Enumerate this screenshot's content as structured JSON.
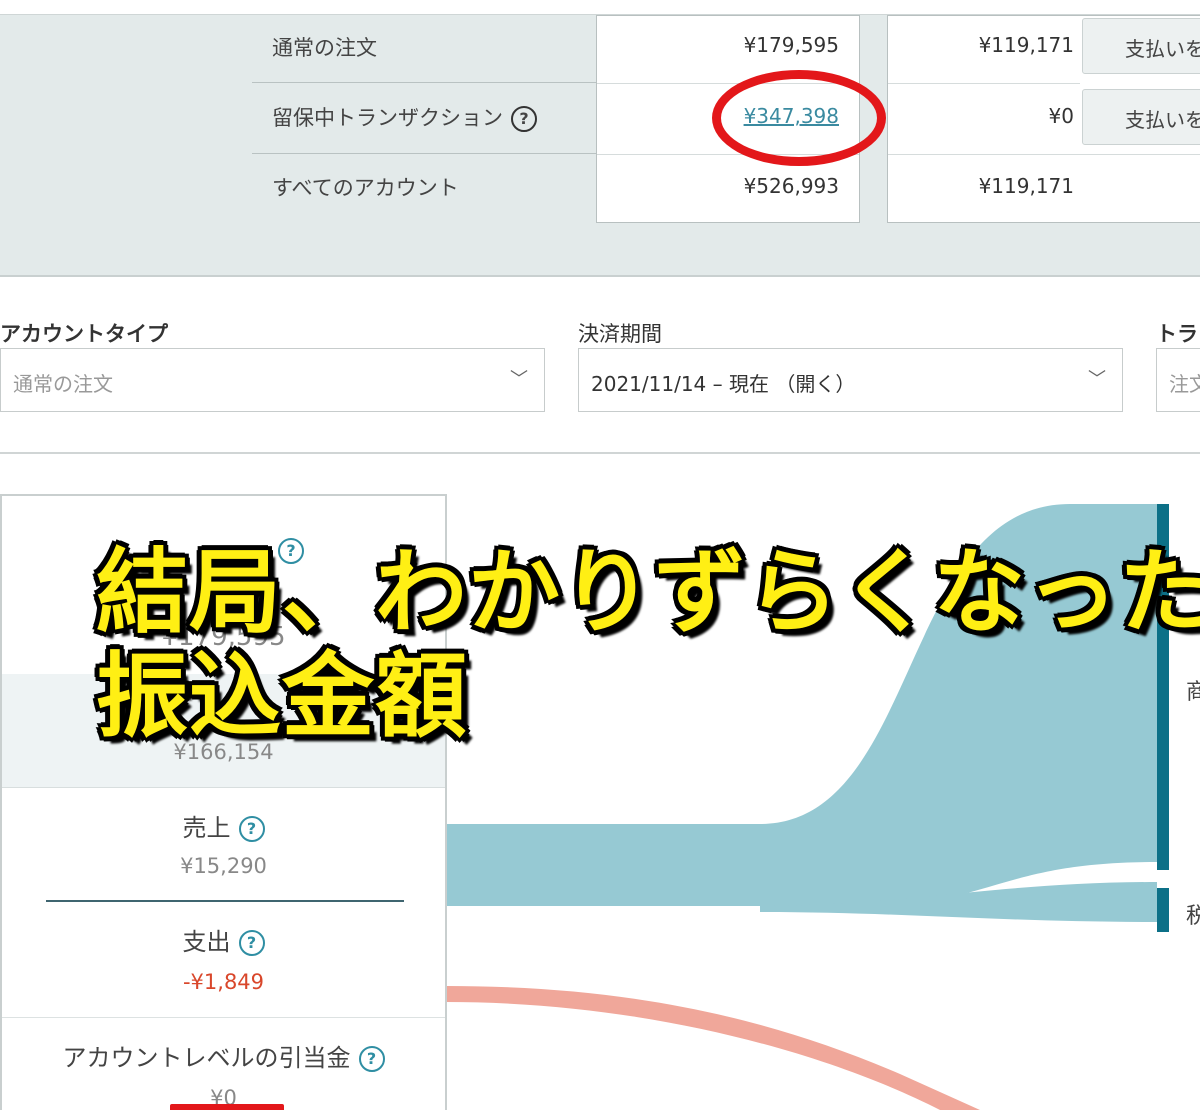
{
  "summary": {
    "rows": [
      {
        "label": "通常の注文",
        "col1": "¥179,595",
        "col2": "¥119,171",
        "button": "支払いを"
      },
      {
        "label": "留保中トランザクション",
        "col1": "¥347,398",
        "col2": "¥0",
        "button": "支払いを"
      },
      {
        "label": "すべてのアカウント",
        "col1": "¥526,993",
        "col2": "¥119,171"
      }
    ],
    "help_icon": "question-circle-icon"
  },
  "filters": {
    "account_type_label": "アカウントタイプ",
    "account_type_value": "通常の注文",
    "period_label": "決済期間",
    "period_value": "2021/11/14 – 現在 （開く）",
    "third_label": "トラ",
    "third_value": "注文"
  },
  "metrics": {
    "top_value": "¥179,595",
    "band_value": "¥166,154",
    "sales_label": "売上",
    "sales_value": "¥15,290",
    "expense_label": "支出",
    "expense_value": "-¥1,849",
    "reserve_label": "アカウントレベルの引当金",
    "reserve_value": "¥0"
  },
  "sankey": {
    "colors": {
      "flow": "#96c9d3",
      "node": "#0c7087",
      "expense": "#f0a79a"
    },
    "side_labels": [
      "商",
      "税"
    ]
  },
  "overlay": {
    "line1": "結局、わかりずらくなった",
    "line2": "振込金額"
  },
  "annotation_colors": {
    "ring": "#e3171a"
  }
}
